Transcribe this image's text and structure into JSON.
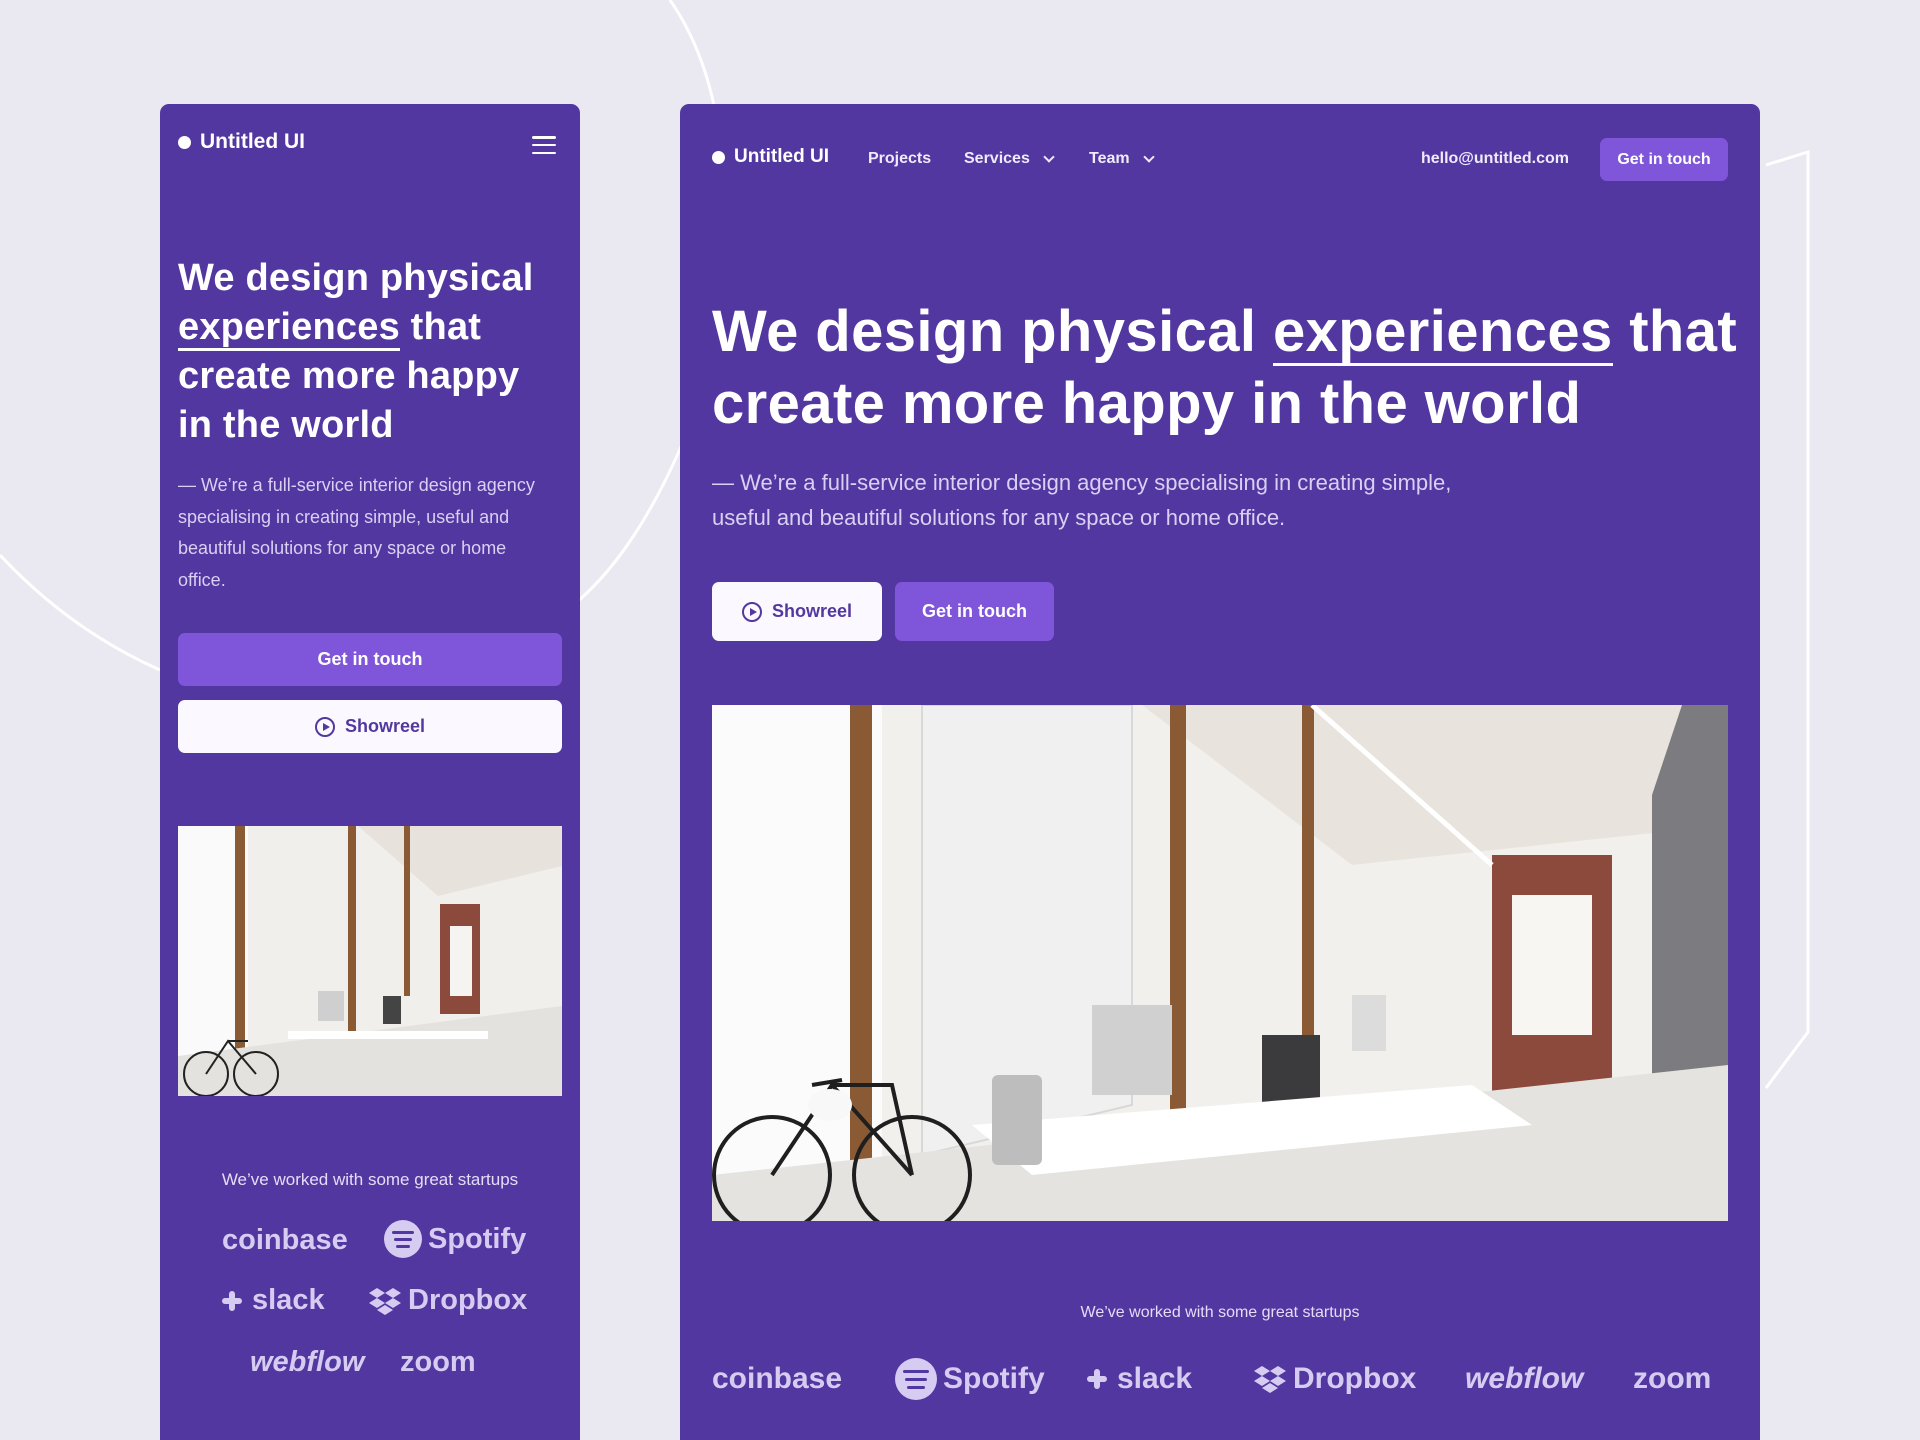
{
  "brand": {
    "name": "Untitled UI"
  },
  "nav": {
    "projects": "Projects",
    "services": "Services",
    "team": "Team",
    "email": "hello@untitled.com",
    "cta": "Get in touch"
  },
  "hero": {
    "title_before": "We design physical",
    "title_highlight": "experiences",
    "title_after_mobile": "that create more happy in the world",
    "title_after_desktop": "that",
    "title_line2_desktop": "create more happy in the world",
    "subtitle": "— We’re a full-service interior design agency specialising in creating simple, useful and beautiful solutions for any space or home office.",
    "showreel_label": "Showreel",
    "cta_label": "Get in touch"
  },
  "logos": {
    "tagline": "We’ve worked with some great startups",
    "items": [
      "coinbase",
      "Spotify",
      "slack",
      "Dropbox",
      "webflow",
      "zoom"
    ]
  },
  "colors": {
    "background": "#eae8f1",
    "panel": "#5237a0",
    "primary_button": "#7f56d9",
    "secondary_button": "#fbf9ff",
    "logo_tint": "#d6ccf2"
  },
  "icons": [
    "menu-icon",
    "play-circle-icon",
    "chevron-down-icon",
    "spotify-logo-icon",
    "slack-logo-icon",
    "dropbox-logo-icon"
  ]
}
